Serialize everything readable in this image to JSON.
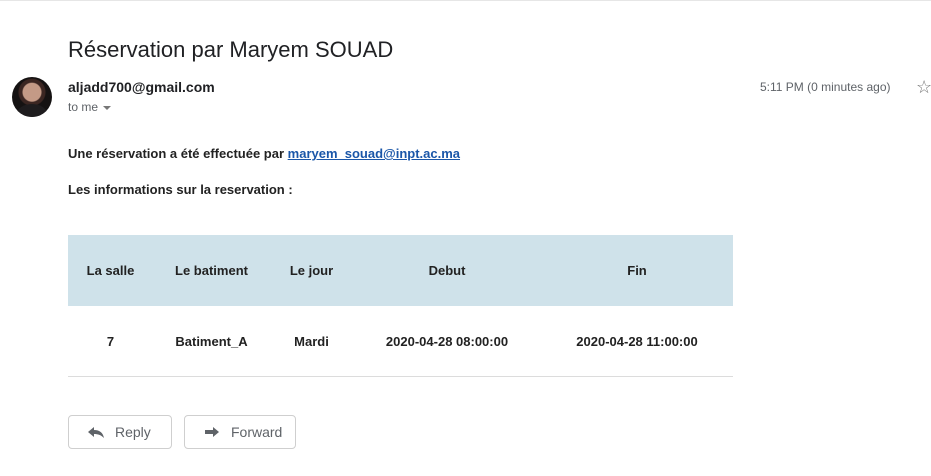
{
  "email": {
    "subject": "Réservation par Maryem SOUAD",
    "sender": "aljadd700@gmail.com",
    "recipient": "to me",
    "timestamp": "5:11 PM (0 minutes ago)"
  },
  "body": {
    "line1_text": "Une réservation a été effectuée par ",
    "line1_link": "maryem_souad@inpt.ac.ma",
    "line2_text": "Les informations sur la reservation :"
  },
  "table": {
    "headers": [
      "La salle",
      "Le batiment",
      "Le jour",
      "Debut",
      "Fin"
    ],
    "rows": [
      [
        "7",
        "Batiment_A",
        "Mardi",
        "2020-04-28 08:00:00",
        "2020-04-28 11:00:00"
      ]
    ]
  },
  "actions": {
    "reply_label": "Reply",
    "forward_label": "Forward"
  },
  "icons": {
    "avatar": "user-avatar",
    "recipient_details": "chevron-down-icon",
    "star": "star-icon",
    "reply": "reply-icon",
    "forward": "forward-icon"
  },
  "colors": {
    "table_header_bg": "#cfe2ea",
    "link": "#1a56a8"
  }
}
